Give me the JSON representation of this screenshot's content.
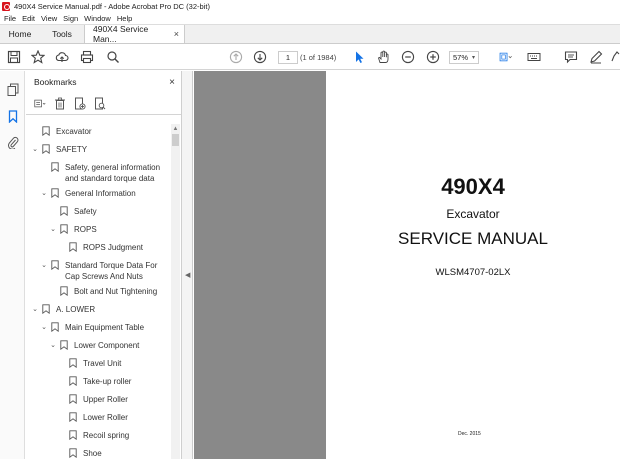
{
  "window": {
    "title": "490X4 Service Manual.pdf - Adobe Acrobat Pro DC (32-bit)"
  },
  "menu": [
    "File",
    "Edit",
    "View",
    "Sign",
    "Window",
    "Help"
  ],
  "tabs": {
    "home": "Home",
    "tools": "Tools",
    "doc": "490X4 Service Man...",
    "doc_close": "×"
  },
  "toolbar": {
    "page_current": "1",
    "page_of": "(1 of 1984)",
    "zoom": "57%",
    "zoom_caret": "▾"
  },
  "bookmarks": {
    "title": "Bookmarks",
    "close": "×",
    "items": [
      {
        "label": "Excavator"
      },
      {
        "label": "SAFETY",
        "chevron": "⌄"
      },
      {
        "label": "Safety, general information and standard torque data"
      },
      {
        "label": "General Information",
        "chevron": "⌄"
      },
      {
        "label": "Safety"
      },
      {
        "label": "ROPS",
        "chevron": "⌄"
      },
      {
        "label": "ROPS Judgment"
      },
      {
        "label": "Standard Torque Data For Cap Screws And Nuts",
        "chevron": "⌄"
      },
      {
        "label": "Bolt and Nut Tightening"
      },
      {
        "label": "A. LOWER",
        "chevron": "⌄"
      },
      {
        "label": "Main Equipment Table",
        "chevron": "⌄"
      },
      {
        "label": "Lower Component",
        "chevron": "⌄"
      },
      {
        "label": "Travel Unit"
      },
      {
        "label": "Take-up roller"
      },
      {
        "label": "Upper Roller"
      },
      {
        "label": "Lower Roller"
      },
      {
        "label": "Recoil spring"
      },
      {
        "label": "Shoe"
      }
    ]
  },
  "scroll": {
    "up": "▲"
  },
  "splitter": {
    "handle": "◀"
  },
  "document": {
    "title": "490X4",
    "subtitle": "Excavator",
    "manual": "SERVICE MANUAL",
    "code": "WLSM4707-02LX",
    "date": "Dec. 2015"
  },
  "colors": {
    "accent": "#1473e6",
    "canvas": "#898989",
    "brand_red": "#d8141d"
  }
}
